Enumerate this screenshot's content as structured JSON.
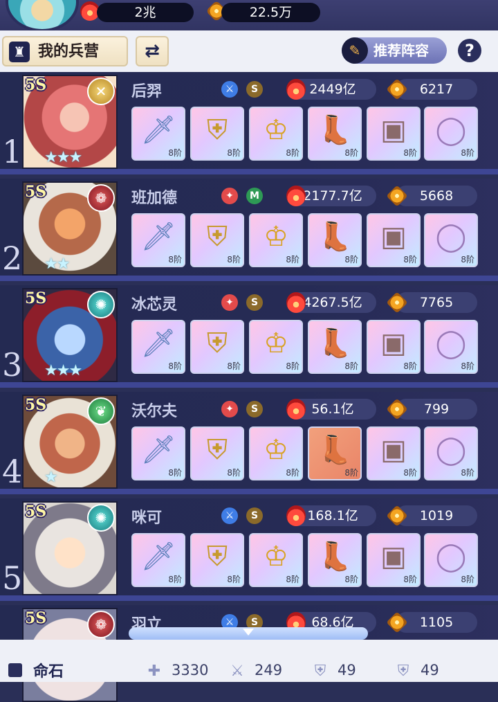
{
  "top": {
    "power_total": "2兆",
    "gems": "22.5万"
  },
  "toolbar": {
    "camp_label": "我的兵营",
    "recommend_label": "推荐阵容",
    "help": "?"
  },
  "heroes": [
    {
      "rank": "1",
      "star": "5S",
      "name": "后羿",
      "element": "blue",
      "grade": "S",
      "power": "2449亿",
      "score": "6217",
      "stars_count": 3,
      "class_icon": "golden-shield-icon",
      "gear": [
        "8阶",
        "8阶",
        "8阶",
        "8阶",
        "8阶",
        "8阶"
      ]
    },
    {
      "rank": "2",
      "star": "5S",
      "name": "班加德",
      "element": "red",
      "grade": "M",
      "power": "2177.7亿",
      "score": "5668",
      "stars_count": 2,
      "class_icon": "red-flame-icon",
      "gear": [
        "8阶",
        "8阶",
        "8阶",
        "8阶",
        "8阶",
        "8阶"
      ]
    },
    {
      "rank": "3",
      "star": "5S",
      "name": "冰芯灵",
      "element": "red",
      "grade": "S",
      "power": "4267.5亿",
      "score": "7765",
      "stars_count": 3,
      "class_icon": "teal-swirl-icon",
      "gear": [
        "8阶",
        "8阶",
        "8阶",
        "8阶",
        "8阶",
        "8阶"
      ]
    },
    {
      "rank": "4",
      "star": "5S",
      "name": "沃尔夫",
      "element": "red",
      "grade": "S",
      "power": "56.1亿",
      "score": "799",
      "stars_count": 1,
      "class_icon": "green-leaf-icon",
      "gear": [
        "8阶",
        "8阶",
        "8阶",
        "8阶",
        "8阶",
        "8阶"
      ]
    },
    {
      "rank": "5",
      "star": "5S",
      "name": "咪可",
      "element": "blue",
      "grade": "S",
      "power": "168.1亿",
      "score": "1019",
      "stars_count": 0,
      "class_icon": "teal-swirl-icon",
      "gear": [
        "8阶",
        "8阶",
        "8阶",
        "8阶",
        "8阶",
        "8阶"
      ]
    },
    {
      "rank": "",
      "star": "5S",
      "name": "羽立",
      "element": "blue",
      "grade": "S",
      "power": "68.6亿",
      "score": "1105",
      "stars_count": 0,
      "class_icon": "red-flame-icon",
      "gear": []
    }
  ],
  "footer": {
    "title": "命石",
    "hp": "3330",
    "atk": "249",
    "def1": "49",
    "def2": "49"
  },
  "colors": {
    "panel_bg": "#262b55",
    "row_divider": "#3e4694",
    "toolbar_bg": "#eef0f7",
    "pill_bg": "#3b4072"
  }
}
